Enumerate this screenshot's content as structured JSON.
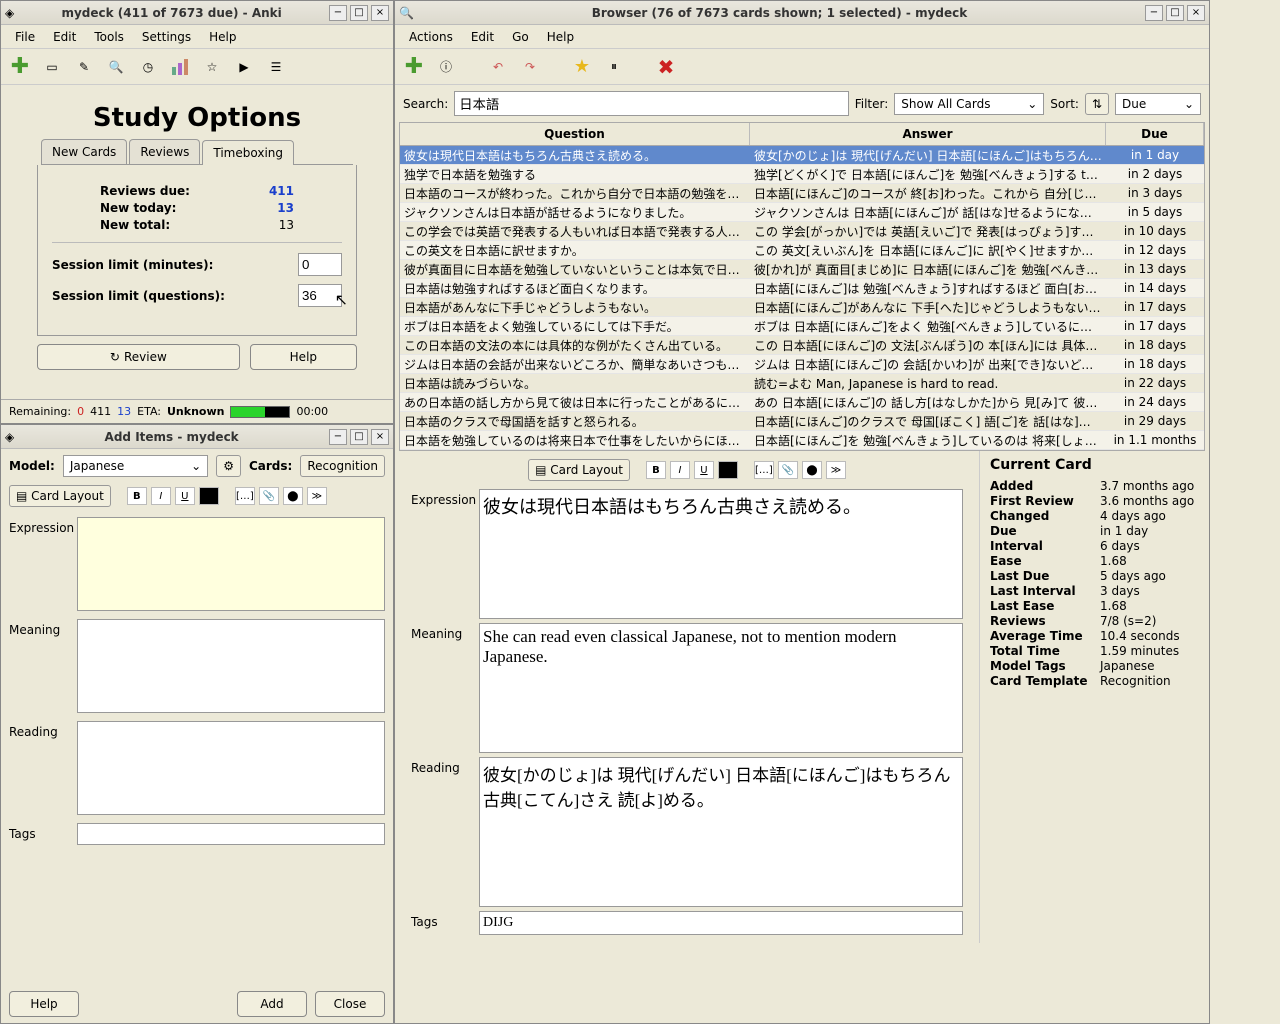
{
  "study": {
    "title": "mydeck (411 of 7673 due) - Anki",
    "menu": [
      "File",
      "Edit",
      "Tools",
      "Settings",
      "Help"
    ],
    "heading": "Study Options",
    "tabs": [
      "New Cards",
      "Reviews",
      "Timeboxing"
    ],
    "reviews_due_label": "Reviews due:",
    "reviews_due": "411",
    "new_today_label": "New today:",
    "new_today": "13",
    "new_total_label": "New total:",
    "new_total": "13",
    "limit_min_label": "Session limit (minutes):",
    "limit_min": "0",
    "limit_q_label": "Session limit (questions):",
    "limit_q": "36",
    "review_btn": "Review",
    "help_btn": "Help",
    "remaining_label": "Remaining:",
    "remaining_0": "0",
    "remaining_411": "411",
    "remaining_13": "13",
    "eta_label": "ETA:",
    "eta_val": "Unknown",
    "time": "00:00"
  },
  "add": {
    "title": "Add Items - mydeck",
    "model_label": "Model:",
    "model_val": "Japanese",
    "cards_label": "Cards:",
    "cards_btn": "Recognition",
    "layout_btn": "Card Layout",
    "fields": {
      "expression": "Expression",
      "meaning": "Meaning",
      "reading": "Reading",
      "tags": "Tags"
    },
    "help_btn": "Help",
    "add_btn": "Add",
    "close_btn": "Close"
  },
  "browser": {
    "title": "Browser (76 of 7673 cards shown; 1 selected) - mydeck",
    "menu": [
      "Actions",
      "Edit",
      "Go",
      "Help"
    ],
    "search_label": "Search:",
    "search_val": "日本語",
    "filter_label": "Filter:",
    "filter_val": "Show All Cards",
    "sort_label": "Sort:",
    "sort_val": "Due",
    "cols": {
      "q": "Question",
      "a": "Answer",
      "d": "Due"
    },
    "rows": [
      {
        "q": "彼女は現代日本語はもちろん古典さえ読める。",
        "a": "彼女[かのじょ]は 現代[げんだい] 日本語[にほんご]はもちろん 古典[こ…",
        "d": "in 1 day"
      },
      {
        "q": "独学で日本語を勉強する",
        "a": "独学[どくがく]で 日本語[にほんご]を 勉強[べんきょう]する teach one…",
        "d": "in 2 days"
      },
      {
        "q": "日本語のコースが終わった。これから自分で日本語の勉強を続けるつ…",
        "a": "日本語[にほんご]のコースが 終[お]わった。これから 自分[じぶん]で …",
        "d": "in 3 days"
      },
      {
        "q": "ジャクソンさんは日本語が話せるようになりました。",
        "a": "ジャクソンさんは 日本語[にほんご]が 話[はな]せるようになりました。…",
        "d": "in 5 days"
      },
      {
        "q": "この学会では英語で発表する人もいれば日本語で発表する人もいる。",
        "a": "この 学会[がっかい]では 英語[えいご]で 発表[はっぴょう]する 人[ひ…",
        "d": "in 10 days"
      },
      {
        "q": "この英文を日本語に訳せますか。",
        "a": "この 英文[えいぶん]を 日本語[にほんご]に 訳[やく]せますか。Can yo…",
        "d": "in 12 days"
      },
      {
        "q": "彼が真面目に日本語を勉強していないということは本気で日本で仕事…",
        "a": "彼[かれ]が 真面目[まじめ]に 日本語[にほんご]を 勉強[べんきょう]し…",
        "d": "in 13 days"
      },
      {
        "q": "日本語は勉強すればするほど面白くなります。",
        "a": "日本語[にほんご]は 勉強[べんきょう]すればするほど 面白[おもしろ]…",
        "d": "in 14 days"
      },
      {
        "q": "日本語があんなに下手じゃどうしようもない。",
        "a": "日本語[にほんご]があんなに 下手[へた]じゃどうしようもない。There …",
        "d": "in 17 days"
      },
      {
        "q": "ボブは日本語をよく勉強しているにしては下手だ。",
        "a": "ボブは 日本語[にほんご]をよく 勉強[べんきょう]しているにしては 下手…",
        "d": "in 17 days"
      },
      {
        "q": "この日本語の文法の本には具体的な例がたくさん出ている。",
        "a": "この 日本語[にほんご]の 文法[ぶんぽう]の 本[ほん]には 具体[ぐたい…",
        "d": "in 18 days"
      },
      {
        "q": "ジムは日本語の会話が出来ないどころか、簡単なあいさつも出来ない。",
        "a": "ジムは 日本語[にほんご]の 会話[かいわ]が 出来[でき]ないどころか、…",
        "d": "in 18 days"
      },
      {
        "q": "日本語は読みづらいな。",
        "a": "読む=よむ Man, Japanese is hard to read.",
        "d": "in 22 days"
      },
      {
        "q": "あの日本語の話し方から見て彼は日本に行ったことがあるに違いない。…",
        "a": "あの 日本語[にほんご]の 話し方[はなしかた]から 見[み]て 彼[かれ]…",
        "d": "in 24 days"
      },
      {
        "q": "日本語のクラスで母国語を話すと怒られる。",
        "a": "日本語[にほんご]のクラスで 母国[ぼこく] 語[ご]を 話[はな]すと 怒[お…",
        "d": "in 29 days"
      },
      {
        "q": "日本語を勉強しているのは将来日本で仕事をしたいからにほかならな…",
        "a": "日本語[にほんご]を 勉強[べんきょう]しているのは 将来[しょうらい] 日…",
        "d": "in 1.1 months"
      }
    ],
    "layout_btn": "Card Layout",
    "editor": {
      "expression_label": "Expression",
      "expression": "彼女は現代日本語はもちろん古典さえ読める。",
      "meaning_label": "Meaning",
      "meaning": "She can read even classical Japanese, not to mention modern Japanese.",
      "reading_label": "Reading",
      "reading": "彼女[かのじょ]は 現代[げんだい] 日本語[にほんご]はもちろん 古典[こてん]さえ 読[よ]める。",
      "tags_label": "Tags",
      "tags": "DIJG"
    },
    "info": {
      "heading": "Current Card",
      "rows": [
        [
          "Added",
          "3.7 months ago"
        ],
        [
          "First Review",
          "3.6 months ago"
        ],
        [
          "Changed",
          "4 days ago"
        ],
        [
          "Due",
          "in 1 day"
        ],
        [
          "Interval",
          "6 days"
        ],
        [
          "Ease",
          "1.68"
        ],
        [
          "Last Due",
          "5 days ago"
        ],
        [
          "Last Interval",
          "3 days"
        ],
        [
          "Last Ease",
          "1.68"
        ],
        [
          "Reviews",
          "7/8 (s=2)"
        ],
        [
          "Average Time",
          "10.4 seconds"
        ],
        [
          "Total Time",
          "1.59 minutes"
        ],
        [
          "Model Tags",
          "Japanese"
        ],
        [
          "Card Template",
          "Recognition"
        ]
      ]
    }
  }
}
